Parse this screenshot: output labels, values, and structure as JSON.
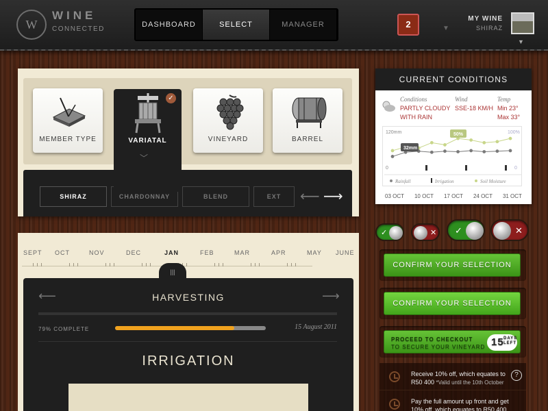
{
  "brand": {
    "logo_letter": "W",
    "name": "WINE",
    "tagline": "CONNECTED"
  },
  "nav": {
    "items": [
      {
        "label": "DASHBOARD"
      },
      {
        "label": "SELECT"
      },
      {
        "label": "MANAGER"
      }
    ],
    "active": "SELECT"
  },
  "notifications": {
    "count": "2"
  },
  "user": {
    "title": "MY WINE",
    "subtitle": "SHIRAZ"
  },
  "selector": {
    "cards": [
      {
        "label": "MEMBER TYPE",
        "icon": "sundial-icon"
      },
      {
        "label": "VARIATAL",
        "icon": "wine-press-icon",
        "selected": true
      },
      {
        "label": "VINEYARD",
        "icon": "grapes-icon"
      },
      {
        "label": "BARREL",
        "icon": "barrel-icon"
      }
    ],
    "varietals": [
      {
        "label": "SHIRAZ"
      },
      {
        "label": "CHARDONNAY"
      },
      {
        "label": "BLEND"
      },
      {
        "label": "EXT"
      }
    ],
    "active_varietal": "SHIRAZ"
  },
  "timeline": {
    "months": [
      "SEPT",
      "OCT",
      "NOV",
      "DEC",
      "JAN",
      "FEB",
      "MAR",
      "APR",
      "MAY",
      "JUNE"
    ],
    "active_month": "JAN",
    "handle_glyph": "|||"
  },
  "harvest": {
    "stage": "HARVESTING",
    "progress_label": "79% COMPLETE",
    "progress": 0.79,
    "date": "15 August 2011",
    "next_stage": "IRRIGATION"
  },
  "conditions": {
    "title": "CURRENT CONDITIONS",
    "headings": {
      "conditions": "Conditions",
      "wind": "Wind",
      "temp": "Temp"
    },
    "values": {
      "conditions_l1": "PARTLY CLOUDY",
      "conditions_l2": "WITH RAIN",
      "wind": "SSE-18 KM/H",
      "temp_min": "Min 23°",
      "temp_max": "Max 33°"
    },
    "chart": {
      "y_left_max": "120mm",
      "y_left_min": "0",
      "y_right_max": "100%",
      "y_right_min": "0",
      "label_rain": "32mm",
      "label_moisture": "50%",
      "legend": {
        "rainfall": "Rainfall",
        "irrigation": "Irrigation",
        "soil": "Soil Moisture"
      },
      "colors": {
        "rainfall": "#7a7a7a",
        "soil": "#c8d68a"
      }
    },
    "chart_data": {
      "type": "line",
      "x": [
        "03 OCT",
        "10 OCT",
        "17 OCT",
        "24 OCT",
        "31 OCT"
      ],
      "series": [
        {
          "name": "Rainfall",
          "values": [
            24,
            32,
            34,
            32,
            34,
            33,
            35,
            33,
            34,
            35
          ]
        },
        {
          "name": "Soil Moisture",
          "values": [
            35,
            42,
            40,
            50,
            46,
            58,
            55,
            50,
            52,
            58
          ]
        }
      ],
      "ylim": [
        0,
        120
      ]
    }
  },
  "toggles": [
    {
      "state": "on",
      "size": "small"
    },
    {
      "state": "off",
      "size": "small"
    },
    {
      "state": "on",
      "size": "large"
    },
    {
      "state": "off",
      "size": "large"
    }
  ],
  "actions": {
    "confirm1": "CONFIRM YOUR SELECTION",
    "confirm2": "CONFIRM YOUR SELECTION",
    "checkout_l1": "PROCEED TO CHECKOUT",
    "checkout_l2": "TO SECURE YOUR VINEYARD",
    "days_num": "15",
    "days_txt": "DAYS LEFT"
  },
  "offers": [
    {
      "line1": "Receive 10% off, which equates to",
      "line2": "R50 400",
      "line3": "*Valid until the 10th October"
    },
    {
      "line1": "Pay the full amount up front and get",
      "line2": "10% off, which equates to R50,400"
    }
  ]
}
